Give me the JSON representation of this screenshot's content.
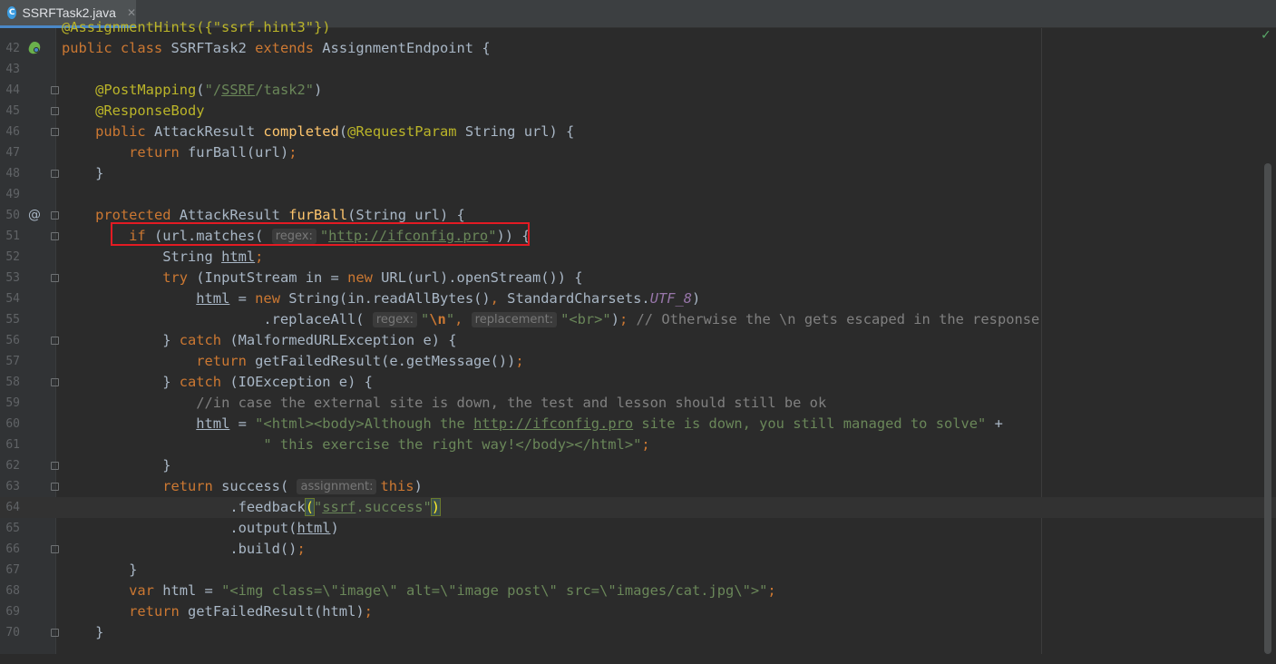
{
  "tab": {
    "icon": "C",
    "label": "SSRFTask2.java",
    "close": "✕"
  },
  "status": {
    "check": "✓"
  },
  "lines": [
    {
      "n": "",
      "parts": [
        [
          "a",
          "@AssignmentHints({\"ssrf.hint3\"})"
        ]
      ]
    },
    {
      "n": "42",
      "icon": "bean",
      "parts": [
        [
          "k",
          "public class "
        ],
        [
          "p",
          "SSRFTask2 "
        ],
        [
          "k",
          "extends "
        ],
        [
          "p",
          "AssignmentEndpoint {"
        ]
      ]
    },
    {
      "n": "43",
      "parts": []
    },
    {
      "n": "44",
      "fold": true,
      "parts": [
        [
          "p",
          "    "
        ],
        [
          "a",
          "@PostMapping"
        ],
        [
          "p",
          "("
        ],
        [
          "s",
          "\"/"
        ],
        [
          "s u",
          "SSRF"
        ],
        [
          "s",
          "/task2\""
        ],
        [
          "p",
          ")"
        ]
      ]
    },
    {
      "n": "45",
      "fold": true,
      "parts": [
        [
          "p",
          "    "
        ],
        [
          "a",
          "@ResponseBody"
        ]
      ]
    },
    {
      "n": "46",
      "fold": true,
      "parts": [
        [
          "p",
          "    "
        ],
        [
          "k",
          "public "
        ],
        [
          "p",
          "AttackResult "
        ],
        [
          "m",
          "completed"
        ],
        [
          "p",
          "("
        ],
        [
          "a",
          "@RequestParam "
        ],
        [
          "p",
          "String url) {"
        ]
      ]
    },
    {
      "n": "47",
      "parts": [
        [
          "p",
          "        "
        ],
        [
          "k",
          "return "
        ],
        [
          "p",
          "furBall(url)"
        ],
        [
          "k",
          ";"
        ]
      ]
    },
    {
      "n": "48",
      "fold": true,
      "parts": [
        [
          "p",
          "    }"
        ]
      ]
    },
    {
      "n": "49",
      "parts": []
    },
    {
      "n": "50",
      "icon": "at",
      "fold": true,
      "parts": [
        [
          "p",
          "    "
        ],
        [
          "k",
          "protected "
        ],
        [
          "p",
          "AttackResult "
        ],
        [
          "m",
          "furBall"
        ],
        [
          "p",
          "(String url) {"
        ]
      ]
    },
    {
      "n": "51",
      "fold": true,
      "parts": [
        [
          "p",
          "        "
        ],
        [
          "k",
          "if "
        ],
        [
          "p",
          "(url.matches( "
        ],
        [
          "h",
          "regex:"
        ],
        [
          "s",
          "\""
        ],
        [
          "s u",
          "http://ifconfig.pro"
        ],
        [
          "s",
          "\""
        ],
        [
          "p",
          ")) {"
        ]
      ]
    },
    {
      "n": "52",
      "parts": [
        [
          "p",
          "            String "
        ],
        [
          "p u",
          "html"
        ],
        [
          "k",
          ";"
        ]
      ]
    },
    {
      "n": "53",
      "fold": true,
      "parts": [
        [
          "p",
          "            "
        ],
        [
          "k",
          "try "
        ],
        [
          "p",
          "(InputStream in = "
        ],
        [
          "k",
          "new "
        ],
        [
          "p",
          "URL(url).openStream()) {"
        ]
      ]
    },
    {
      "n": "54",
      "parts": [
        [
          "p",
          "                "
        ],
        [
          "p u",
          "html"
        ],
        [
          "p",
          " = "
        ],
        [
          "k",
          "new "
        ],
        [
          "p",
          "String(in.readAllBytes()"
        ],
        [
          "k",
          ", "
        ],
        [
          "p",
          "StandardCharsets."
        ],
        [
          "n",
          "UTF_8"
        ],
        [
          "p",
          ")"
        ]
      ]
    },
    {
      "n": "55",
      "parts": [
        [
          "p",
          "                        .replaceAll( "
        ],
        [
          "h",
          "regex:"
        ],
        [
          "s",
          "\""
        ],
        [
          "e",
          "\\n"
        ],
        [
          "s",
          "\""
        ],
        [
          "k",
          ", "
        ],
        [
          "h",
          "replacement:"
        ],
        [
          "s",
          "\"<br>\""
        ],
        [
          "p",
          ")"
        ],
        [
          "k",
          "; "
        ],
        [
          "c",
          "// Otherwise the \\n gets escaped in the response"
        ]
      ]
    },
    {
      "n": "56",
      "fold": true,
      "parts": [
        [
          "p",
          "            } "
        ],
        [
          "k",
          "catch "
        ],
        [
          "p",
          "(MalformedURLException e) {"
        ]
      ]
    },
    {
      "n": "57",
      "parts": [
        [
          "p",
          "                "
        ],
        [
          "k",
          "return "
        ],
        [
          "p",
          "getFailedResult(e.getMessage())"
        ],
        [
          "k",
          ";"
        ]
      ]
    },
    {
      "n": "58",
      "fold": true,
      "parts": [
        [
          "p",
          "            } "
        ],
        [
          "k",
          "catch "
        ],
        [
          "p",
          "(IOException e) {"
        ]
      ]
    },
    {
      "n": "59",
      "parts": [
        [
          "p",
          "                "
        ],
        [
          "c",
          "//in case the external site is down, the test and lesson should still be ok"
        ]
      ]
    },
    {
      "n": "60",
      "parts": [
        [
          "p",
          "                "
        ],
        [
          "p u",
          "html"
        ],
        [
          "p",
          " = "
        ],
        [
          "s",
          "\"<html><body>Although the "
        ],
        [
          "s u",
          "http://ifconfig.pro"
        ],
        [
          "s",
          " site is down, you still managed to solve\" "
        ],
        [
          "p",
          "+"
        ]
      ]
    },
    {
      "n": "61",
      "parts": [
        [
          "p",
          "                        "
        ],
        [
          "s",
          "\" this exercise the right way!</body></html>\""
        ],
        [
          "k",
          ";"
        ]
      ]
    },
    {
      "n": "62",
      "fold": true,
      "parts": [
        [
          "p",
          "            }"
        ]
      ]
    },
    {
      "n": "63",
      "fold": true,
      "parts": [
        [
          "p",
          "            "
        ],
        [
          "k",
          "return "
        ],
        [
          "p",
          "success( "
        ],
        [
          "h",
          "assignment:"
        ],
        [
          "k",
          "this"
        ],
        [
          "p",
          ")"
        ]
      ]
    },
    {
      "n": "64",
      "current": true,
      "parts": [
        [
          "p",
          "                    .feedback"
        ],
        [
          "b",
          "("
        ],
        [
          "s",
          "\""
        ],
        [
          "s u",
          "ssrf"
        ],
        [
          "s",
          ".success\""
        ],
        [
          "b",
          ")"
        ]
      ]
    },
    {
      "n": "65",
      "parts": [
        [
          "p",
          "                    .output("
        ],
        [
          "p u",
          "html"
        ],
        [
          "p",
          ")"
        ]
      ]
    },
    {
      "n": "66",
      "fold": true,
      "parts": [
        [
          "p",
          "                    .build()"
        ],
        [
          "k",
          ";"
        ]
      ]
    },
    {
      "n": "67",
      "parts": [
        [
          "p",
          "        }"
        ]
      ]
    },
    {
      "n": "68",
      "parts": [
        [
          "p",
          "        "
        ],
        [
          "k",
          "var "
        ],
        [
          "p",
          "html = "
        ],
        [
          "s",
          "\"<img class=\\\"image\\\" alt=\\\"image post\\\" src=\\\"images/cat.jpg\\\">\""
        ],
        [
          "k",
          ";"
        ]
      ]
    },
    {
      "n": "69",
      "parts": [
        [
          "p",
          "        "
        ],
        [
          "k",
          "return "
        ],
        [
          "p",
          "getFailedResult(html)"
        ],
        [
          "k",
          ";"
        ]
      ]
    },
    {
      "n": "70",
      "fold": true,
      "parts": [
        [
          "p",
          "    }"
        ]
      ]
    },
    {
      "n": "",
      "parts": []
    }
  ]
}
